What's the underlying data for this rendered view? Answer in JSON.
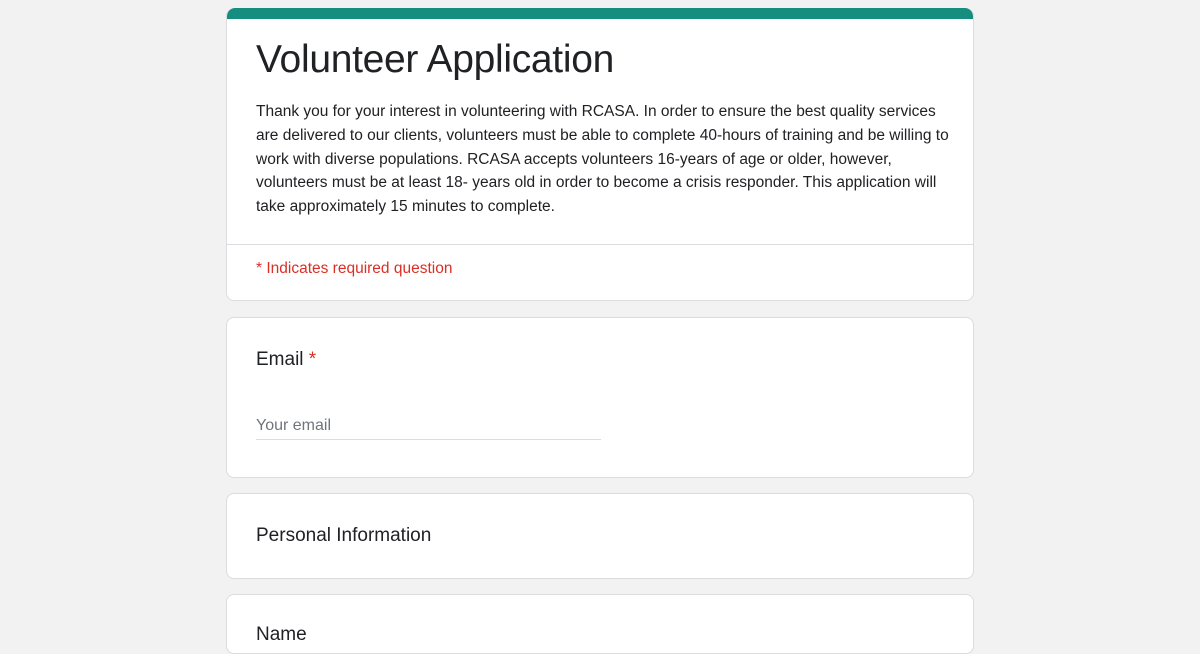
{
  "colors": {
    "accent": "#168e7f",
    "page_background": "#f2f2f2",
    "required": "#d93025"
  },
  "form": {
    "title": "Volunteer Application",
    "description": "Thank you for your interest in volunteering with RCASA. In order to ensure the best quality services are delivered to our clients, volunteers must be able to complete 40-hours of training and be willing to work with diverse populations. RCASA accepts volunteers 16-years of age or older, however, volunteers must be at least 18- years old in order to become a crisis responder. This application will take approximately 15 minutes to complete.",
    "required_note": "* Indicates required question"
  },
  "questions": {
    "email": {
      "label": "Email",
      "required_marker": "*",
      "placeholder": "Your email",
      "value": ""
    }
  },
  "sections": {
    "personal_information": {
      "title": "Personal Information"
    }
  },
  "next_question": {
    "label": "Name"
  }
}
